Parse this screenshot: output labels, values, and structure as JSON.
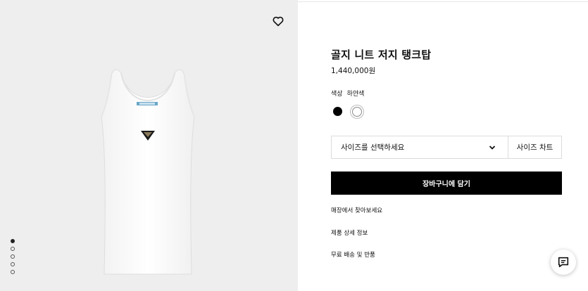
{
  "product": {
    "title": "골지 니트 저지 탱크탑",
    "price": "1,440,000원"
  },
  "color": {
    "label": "색상",
    "selected": "하얀색",
    "swatches": [
      {
        "name": "black",
        "hex": "#000000"
      },
      {
        "name": "white",
        "hex": "#ffffff"
      }
    ]
  },
  "size": {
    "placeholder": "사이즈를 선택하세요",
    "chart_label": "사이즈 차트"
  },
  "cart": {
    "button_label": "장바구니에 담기"
  },
  "links": [
    {
      "label": "매장에서 찾아보세요"
    },
    {
      "label": "제품 상세 정보"
    },
    {
      "label": "무료 배송 및 반품"
    }
  ],
  "gallery": {
    "image_count": 5,
    "active_index": 0,
    "background": "#eeeeee"
  },
  "icons": {
    "wishlist": "heart-icon",
    "size_dropdown": "chevron-down-icon",
    "chat": "chat-icon"
  }
}
